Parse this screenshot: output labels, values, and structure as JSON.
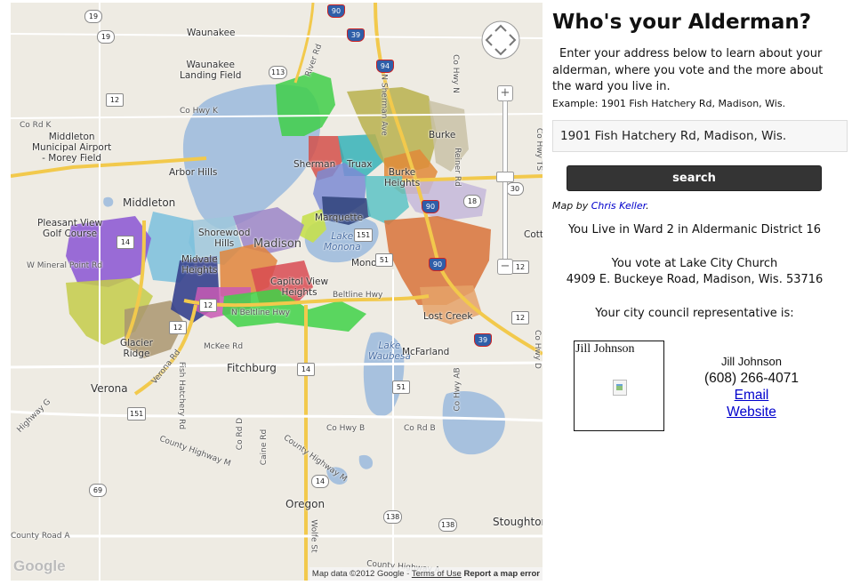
{
  "map": {
    "place_labels": {
      "waunakee": "Waunakee",
      "waunakee_landing": "Waunakee\nLanding Field",
      "middleton_airport": "Middleton\nMunicipal Airport\n- Morey Field",
      "arbor_hills": "Arbor Hills",
      "middleton": "Middleton",
      "pleasant_view": "Pleasant View\nGolf Course",
      "sherman": "Sherman",
      "truax": "Truax",
      "burke_heights": "Burke\nHeights",
      "burke": "Burke",
      "shorewood": "Shorewood\nHills",
      "madison": "Madison",
      "marquette": "Marquette",
      "lake_monona": "Lake\nMonona",
      "midvale": "Midvale\nHeights",
      "capitol_view": "Capitol View\nHeights",
      "monona": "Monona",
      "glacier_ridge": "Glacier\nRidge",
      "lost_creek": "Lost Creek",
      "lake_waubesa": "Lake\nWaubesa",
      "mcfarland": "McFarland",
      "fitchburg": "Fitchburg",
      "verona": "Verona",
      "oregon": "Oregon",
      "stoughton": "Stoughton",
      "cotta": "Cotta"
    },
    "road_labels": {
      "co_rd_k": "Co Rd K",
      "co_hwy_k": "Co Hwy K",
      "w_mineral_point": "W Mineral Point Rd",
      "beltline1": "Beltline Hwy",
      "n_beltline": "N Beltline Hwy",
      "mckee": "McKee Rd",
      "verona_rd": "Verona Rd",
      "fish_hatchery": "Fish Hatchery Rd",
      "co_rd_d": "Co Rd D",
      "caine": "Caine Rd",
      "county_hwy_m1": "County Highway M",
      "county_hwy_m2": "County Highway M",
      "co_hwy_b": "Co Hwy B",
      "co_rd_b": "Co Rd B",
      "highway_g": "Highway G",
      "county_road_a": "County Road A",
      "co_hwy_n": "Co Hwy N",
      "co_hwy_ab": "Co Hwy AB",
      "river_rd": "River Rd",
      "n_sherman": "N Sherman Ave",
      "reiner": "Reiner Rd",
      "county_hwy_a": "County Highway A",
      "wolfe": "Wolfe St",
      "co_hwy_ts": "Co Hwy TS",
      "co_hwy_d": "Co Hwy D"
    },
    "shields": {
      "s19a": "19",
      "s19b": "19",
      "s113": "113",
      "s12a": "12",
      "s14a": "14",
      "s12b": "12",
      "s12c": "12",
      "s14b": "14",
      "s151a": "151",
      "s151b": "151",
      "s51a": "51",
      "s51b": "51",
      "s90a": "90",
      "s90b": "90",
      "s90c": "90",
      "s39a": "39",
      "s39b": "39",
      "s94": "94",
      "s30": "30",
      "s18": "18",
      "s69": "69",
      "s138a": "138",
      "s138b": "138",
      "s14c": "14",
      "s12d": "12",
      "s12e": "12"
    },
    "zoom_in_label": "+",
    "zoom_out_label": "−",
    "logo": "Google",
    "attribution": {
      "data": "Map data ©2012 Google",
      "terms": "Terms of Use",
      "report": "Report a map error"
    }
  },
  "panel": {
    "title": "Who's your Alderman?",
    "intro": "Enter your address below to learn about your alderman, where you vote and the more about the ward you live in.",
    "example": "Example: 1901 Fish Hatchery Rd, Madison, Wis.",
    "address_value": "1901 Fish Hatchery Rd, Madison, Wis.",
    "search_label": "search",
    "credit_prefix": "Map by ",
    "credit_link": "Chris Keller",
    "credit_suffix": ".",
    "ward_line": "You Live in Ward 2 in Aldermanic District 16",
    "vote_line1": "You vote at Lake City Church",
    "vote_line2": "4909 E. Buckeye Road, Madison, Wis. 53716",
    "rep_heading": "Your city council representative is:",
    "photo_name": "Jill Johnson",
    "rep": {
      "name": "Jill Johnson",
      "phone": "(608) 266-4071",
      "email": "Email",
      "website": "Website"
    }
  }
}
